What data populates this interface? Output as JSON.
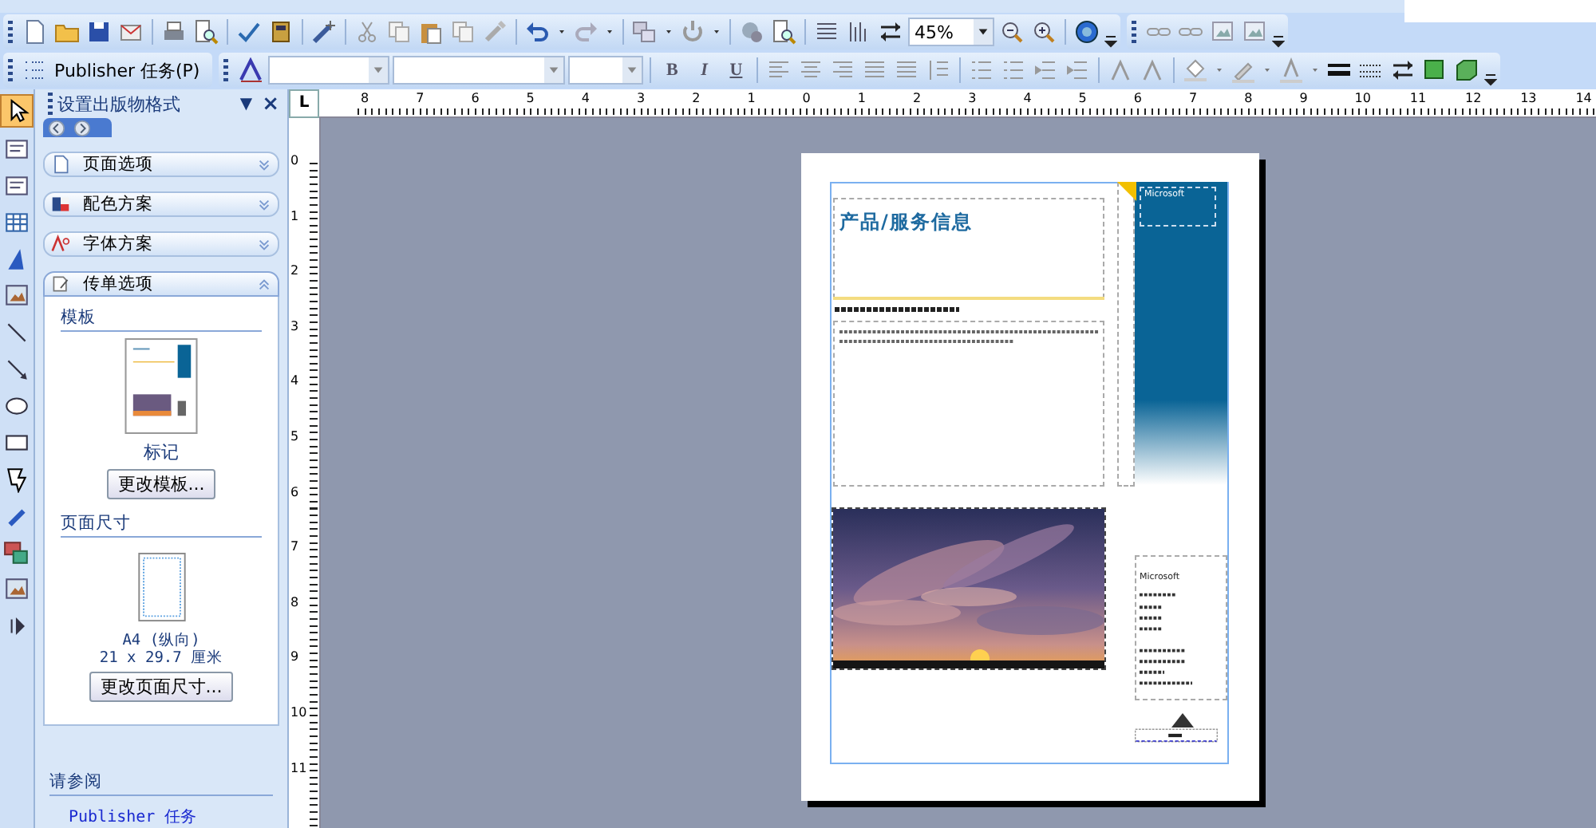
{
  "toolbar": {
    "tasks_button": "Publisher 任务(P)",
    "zoom_value": "45%",
    "format_buttons": [
      "B",
      "I",
      "U"
    ]
  },
  "task_pane": {
    "title": "设置出版物格式",
    "menu_glyph": "▼",
    "close_glyph": "×",
    "sections": [
      {
        "label": "页面选项",
        "selected": false,
        "expanded": false
      },
      {
        "label": "配色方案",
        "selected": false,
        "expanded": false
      },
      {
        "label": "字体方案",
        "selected": false,
        "expanded": false
      },
      {
        "label": "传单选项",
        "selected": true,
        "expanded": true
      }
    ],
    "template_heading": "模板",
    "template_name": "标记",
    "change_template_button": "更改模板...",
    "page_size_heading": "页面尺寸",
    "page_size_name": "A4 (纵向)",
    "page_size_dims": "21 x 29.7 厘米",
    "change_page_size_button": "更改页面尺寸...",
    "see_also_heading": "请参阅",
    "see_also_link": "Publisher 任务"
  },
  "ruler": {
    "corner": "L",
    "horizontal": [
      "8",
      "7",
      "6",
      "5",
      "4",
      "3",
      "2",
      "1",
      "0",
      "1",
      "2",
      "3",
      "4",
      "5",
      "6",
      "7",
      "8",
      "9",
      "10",
      "11",
      "12",
      "13",
      "14"
    ],
    "vertical": [
      "0",
      "1",
      "2",
      "3",
      "4",
      "5",
      "6",
      "7",
      "8",
      "9",
      "10",
      "11"
    ]
  },
  "publication": {
    "title": "产品/服务信息",
    "sidebar_text": "Microsoft",
    "contact_text": "Microsoft"
  }
}
